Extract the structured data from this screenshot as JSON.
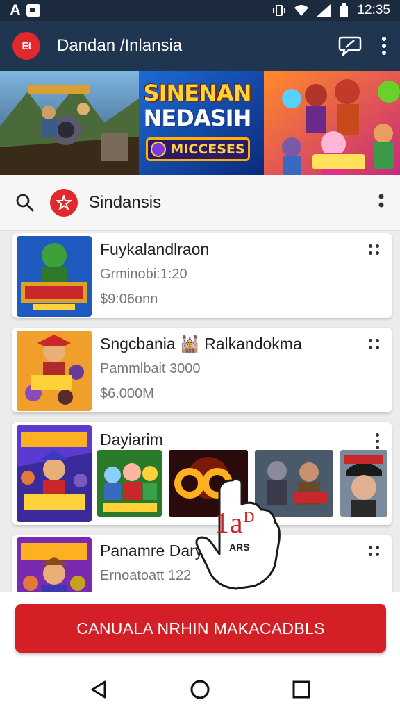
{
  "status_bar": {
    "left_letter": "A",
    "time": "12:35"
  },
  "app_bar": {
    "logo_text": "Et",
    "title": "Dandan /Inlansia",
    "actions": [
      "chat-icon",
      "more-vert-icon"
    ]
  },
  "banner": {
    "title_line1": "SINENAN",
    "title_line2": "NEDASIH",
    "badge_text": "MICCESES"
  },
  "search": {
    "badge_icon": "star-person-icon",
    "text": "Sindansis"
  },
  "cards": [
    {
      "title": "Fuykalandlraon",
      "subtitle": "Grminobi:1:20",
      "price": "$9:06onn"
    },
    {
      "title": "Sngcbania 🕍 Ralkandokma",
      "subtitle": "Pammlbait 3000",
      "price": "$6.000M"
    },
    {
      "title": "Dayiarim",
      "subtitle": "",
      "price": ""
    },
    {
      "title": "Panamre Dary",
      "subtitle": "Ernoatoatt 122",
      "price": ""
    }
  ],
  "overlay": {
    "number": "1a",
    "superscript": "D",
    "label": "ARS"
  },
  "cta": {
    "label": "CANUALA NRHIN MAKACADBLS"
  },
  "colors": {
    "appbar": "#1f3550",
    "accent_red": "#d51f26",
    "statusbar": "#1b2a3c"
  }
}
